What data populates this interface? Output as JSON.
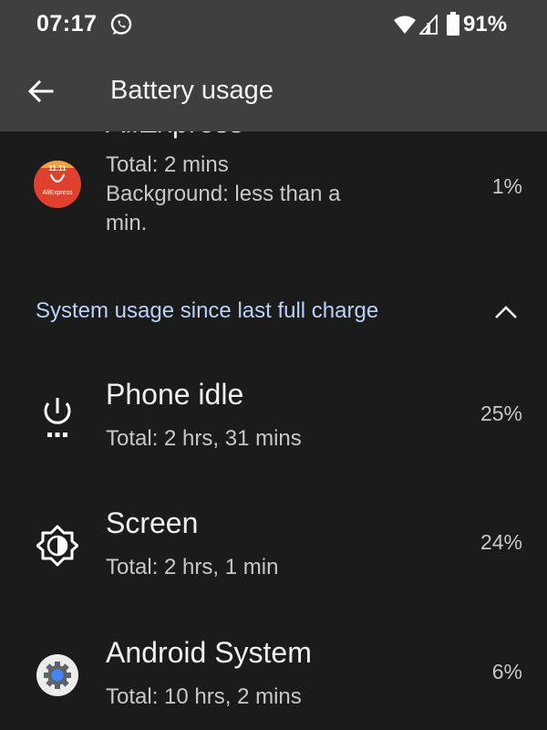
{
  "status_bar": {
    "time": "07:17",
    "battery_level": "91%",
    "icons": [
      "whatsapp-icon",
      "wifi-icon",
      "signal-icon",
      "battery-icon"
    ]
  },
  "app_bar": {
    "title": "Battery usage",
    "back_icon": "arrow-left-icon"
  },
  "app_usage": [
    {
      "name": "AliExpress",
      "total": "Total: 2 mins",
      "background_line1": "Background: less than a",
      "background_line2": "min.",
      "percent": "1%",
      "logo_badge": "11.11",
      "logo_text": "AliExpress"
    }
  ],
  "system_section": {
    "label": "System usage since last full charge",
    "toggle_icon": "chevron-up-icon",
    "items": [
      {
        "name": "Phone idle",
        "total": "Total: 2 hrs, 31 mins",
        "percent": "25%",
        "icon": "power-idle-icon"
      },
      {
        "name": "Screen",
        "total": "Total: 2 hrs, 1 min",
        "percent": "24%",
        "icon": "brightness-icon"
      },
      {
        "name": "Android System",
        "total": "Total: 10 hrs, 2 mins",
        "percent": "6%",
        "icon": "android-system-gear-icon"
      }
    ]
  },
  "colors": {
    "background": "#1b1b1b",
    "app_bar": "#3f3f3f",
    "section_accent": "#b9d2f5",
    "aliexpress_red": "#e0412e",
    "android_blue": "#4285f4"
  }
}
